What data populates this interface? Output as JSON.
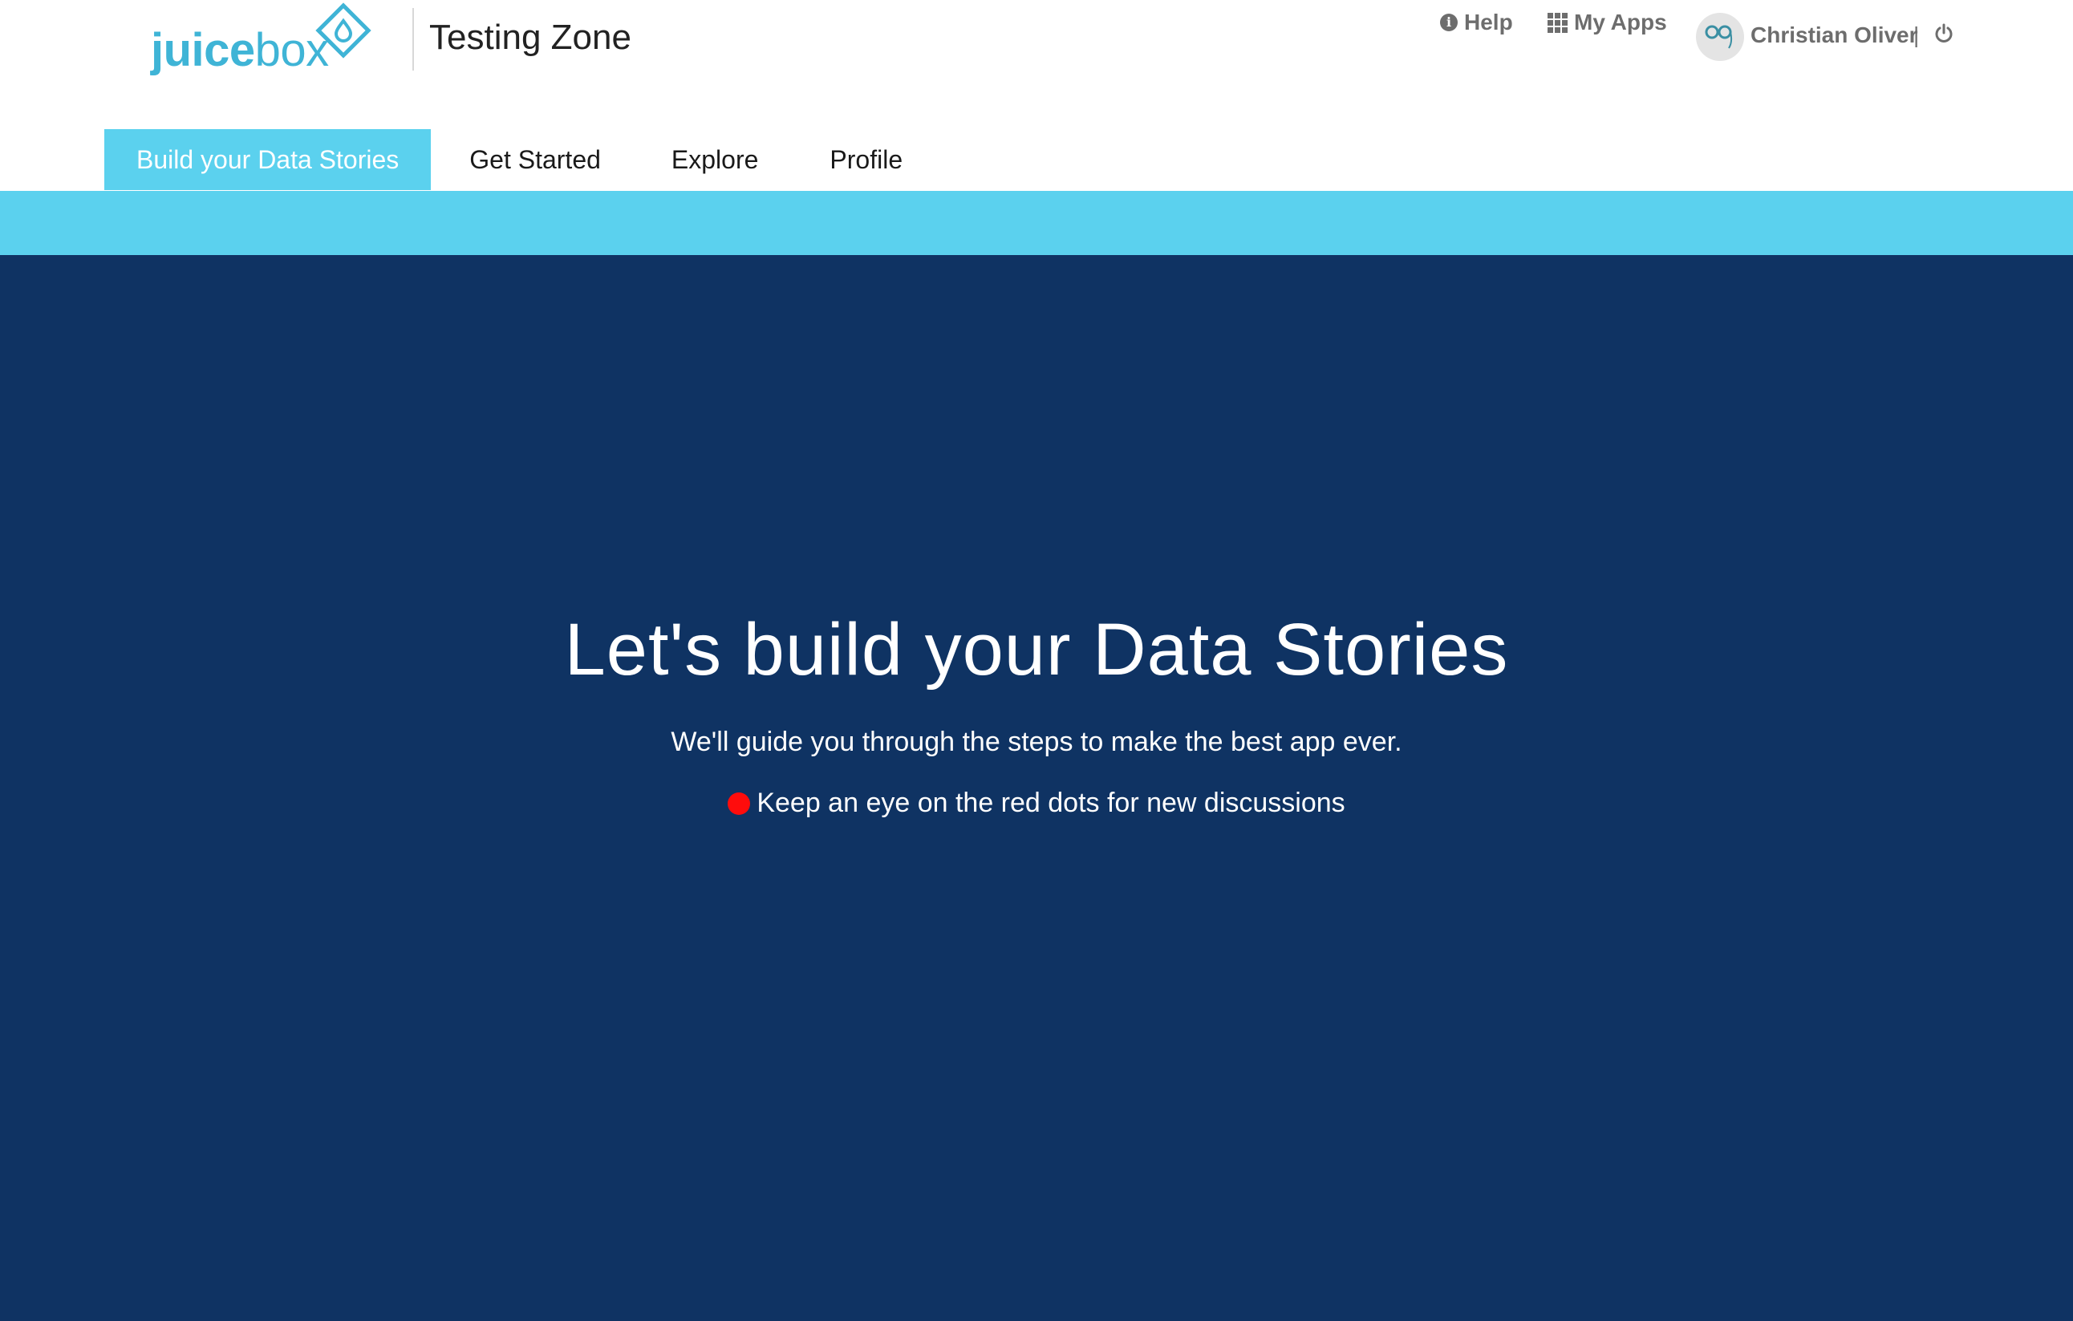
{
  "brand": {
    "logo_regular_part": "box",
    "logo_bold_part": "juice",
    "logo_color": "#3fb4d6"
  },
  "header": {
    "app_title": "Testing Zone",
    "help_label": "Help",
    "apps_label": "My Apps",
    "user_name": "Christian Oliver",
    "user_separator": "|",
    "help_icon": "info-circle-icon",
    "apps_icon": "grid-icon",
    "power_icon": "power-icon"
  },
  "tabs": [
    {
      "label": "Build your Data Stories",
      "active": true
    },
    {
      "label": "Get Started",
      "active": false
    },
    {
      "label": "Explore",
      "active": false
    },
    {
      "label": "Profile",
      "active": false
    }
  ],
  "hero": {
    "title": "Let's build your Data Stories",
    "subtitle": "We'll guide you through the steps to make the best app ever.",
    "note": "Keep an eye on the red dots for new discussions"
  },
  "colors": {
    "accent": "#5bd1ee",
    "hero_background": "#0f3363",
    "red_dot": "#ff0c0c",
    "header_text": "#6d6d6d"
  }
}
